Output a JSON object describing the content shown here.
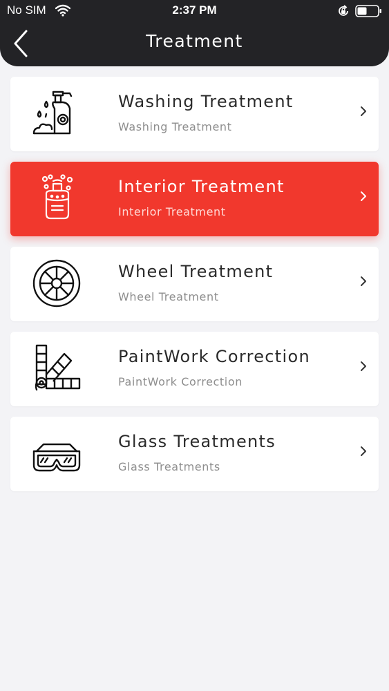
{
  "status_bar": {
    "carrier": "No SIM",
    "time": "2:37 PM"
  },
  "nav": {
    "title": "Treatment"
  },
  "colors": {
    "header_bg": "#232326",
    "accent": "#f1382d",
    "page_bg": "#f3f3f6",
    "card_bg": "#ffffff"
  },
  "items": [
    {
      "title": "Washing Treatment",
      "subtitle": "Washing Treatment",
      "icon": "washing-bottle-icon",
      "selected": false
    },
    {
      "title": "Interior Treatment",
      "subtitle": "Interior Treatment",
      "icon": "spray-bottle-icon",
      "selected": true
    },
    {
      "title": "Wheel Treatment",
      "subtitle": "Wheel Treatment",
      "icon": "wheel-icon",
      "selected": false
    },
    {
      "title": "PaintWork Correction",
      "subtitle": "PaintWork Correction",
      "icon": "paint-swatch-icon",
      "selected": false
    },
    {
      "title": "Glass Treatments",
      "subtitle": "Glass Treatments",
      "icon": "glasses-icon",
      "selected": false
    }
  ]
}
